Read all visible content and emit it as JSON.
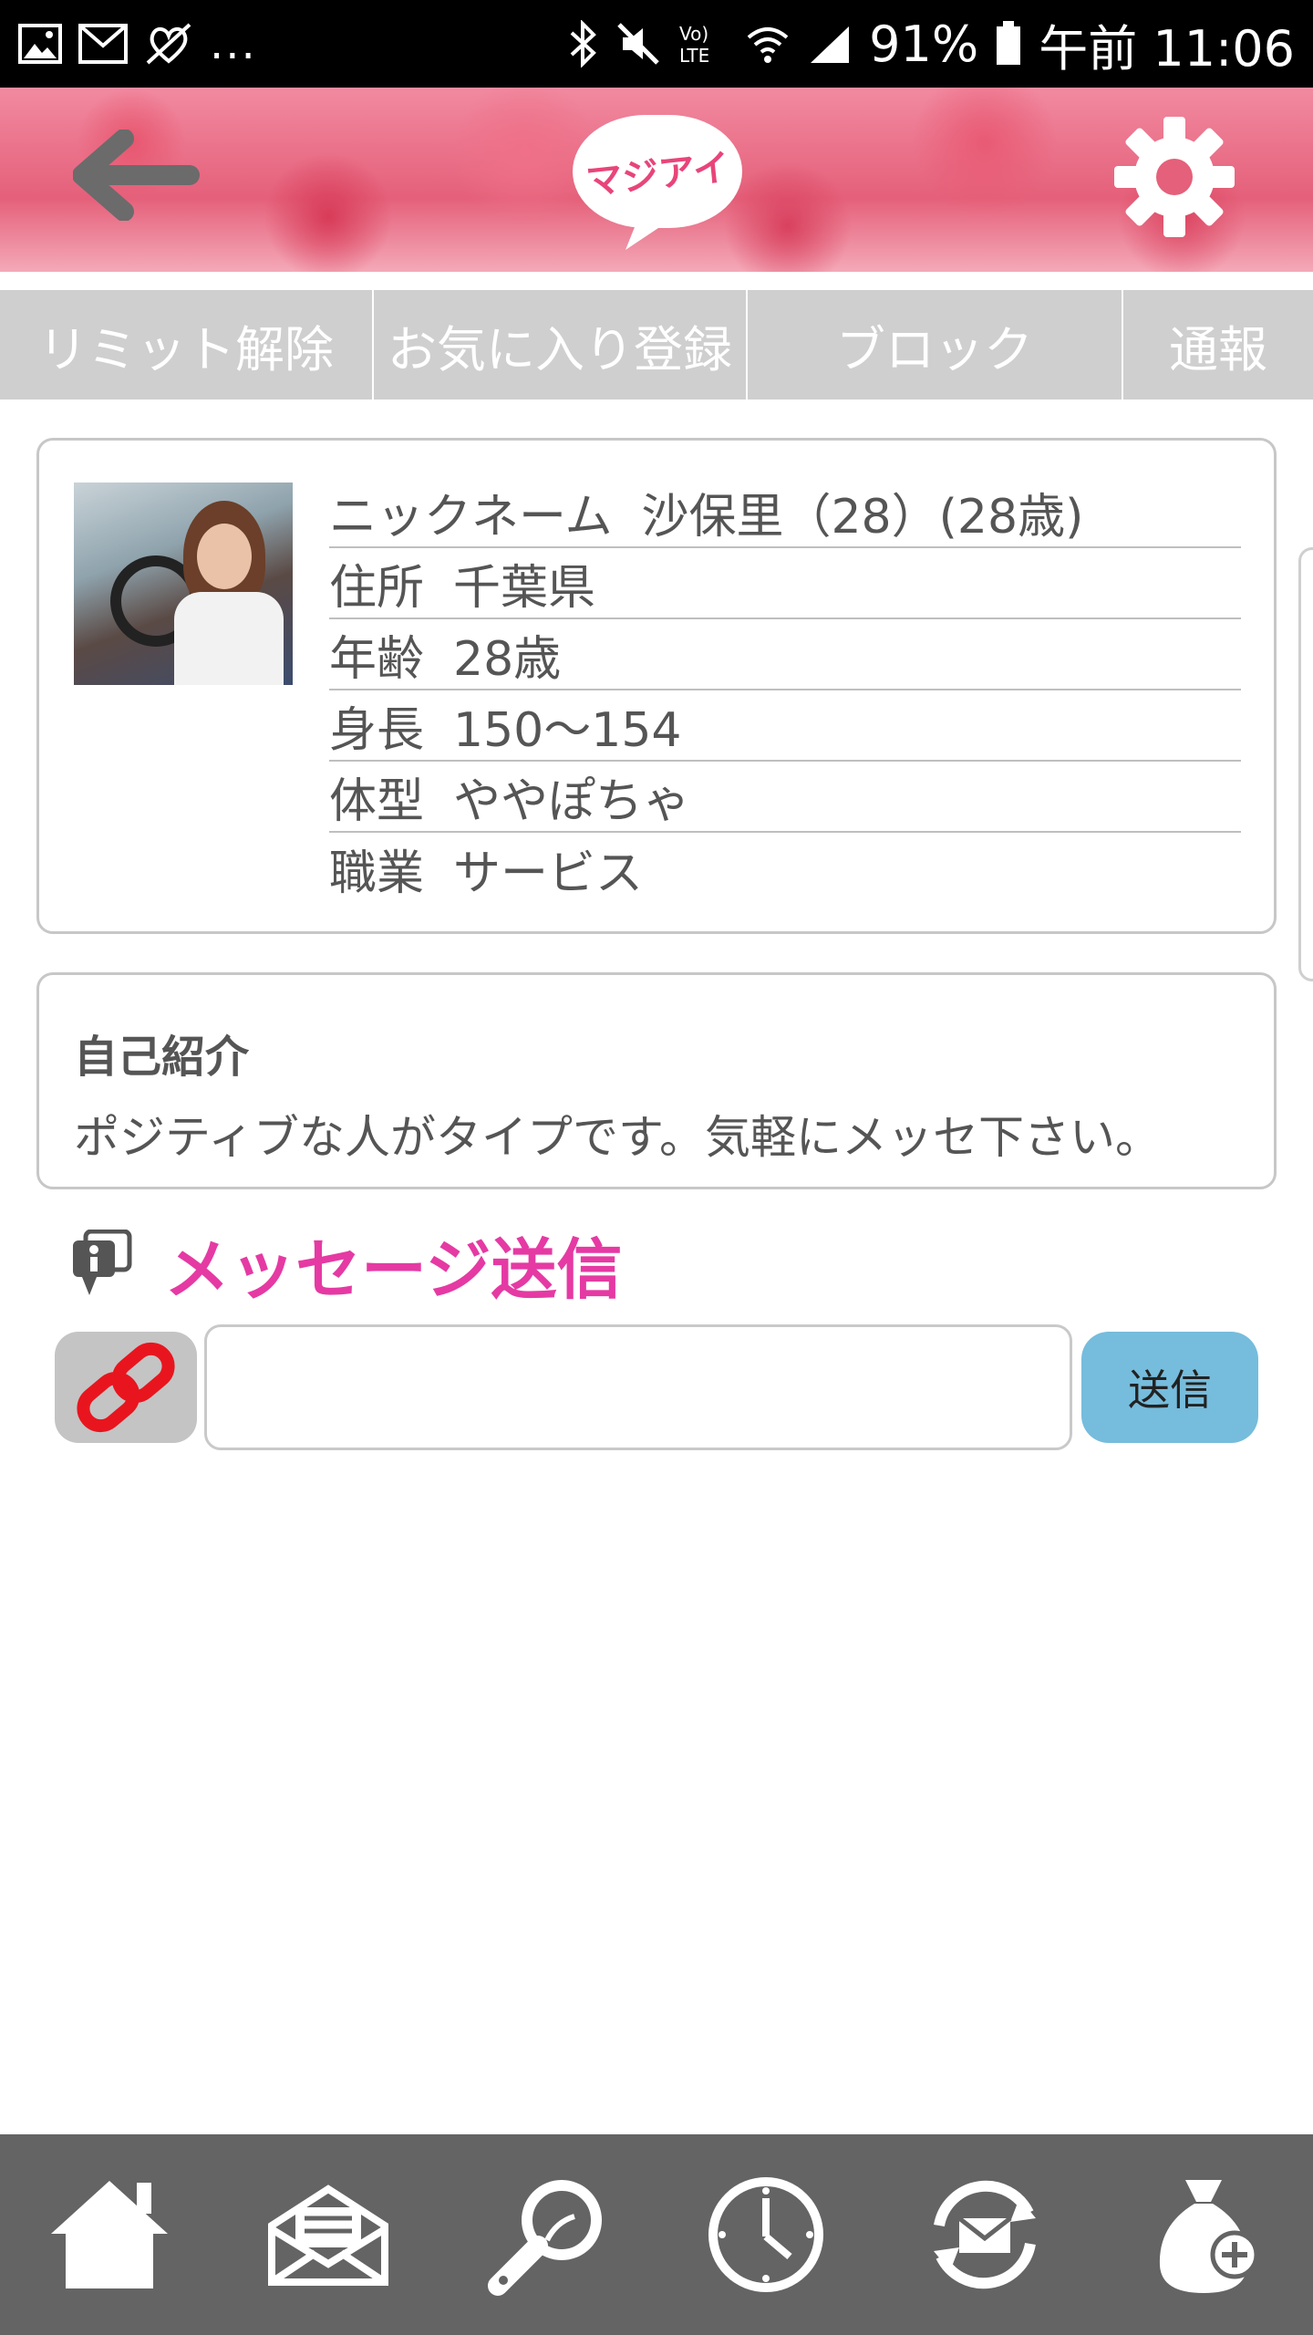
{
  "status_bar": {
    "battery": "91%",
    "time": "午前 11:06",
    "network": "LTE",
    "notifications_more": "..."
  },
  "header": {
    "logo_text": "マジアイ",
    "back_icon": "back-arrow-icon",
    "settings_icon": "gear-icon"
  },
  "tabs": [
    {
      "label": "リミット解除"
    },
    {
      "label": "お気に入り登録"
    },
    {
      "label": "ブロック"
    },
    {
      "label": "通報"
    }
  ],
  "profile": {
    "rows": [
      {
        "key": "ニックネーム",
        "value": "沙保里（28）(28歳)"
      },
      {
        "key": "住所",
        "value": "千葉県"
      },
      {
        "key": "年齢",
        "value": "28歳"
      },
      {
        "key": "身長",
        "value": "150～154"
      },
      {
        "key": "体型",
        "value": "ややぽちゃ"
      },
      {
        "key": "職業",
        "value": "サービス"
      }
    ]
  },
  "intro": {
    "title": "自己紹介",
    "text": "ポジティブな人がタイプです。気軽にメッセ下さい。"
  },
  "message": {
    "title": "メッセージ送信",
    "input_value": "",
    "send_label": "送信"
  },
  "colors": {
    "accent_pink": "#e53aa3",
    "send_button": "#76bcdc",
    "tab_bar": "#cfcfcf",
    "bottom_nav": "#646464"
  },
  "bottom_nav": [
    {
      "icon": "home-icon"
    },
    {
      "icon": "mail-icon"
    },
    {
      "icon": "search-icon"
    },
    {
      "icon": "clock-icon"
    },
    {
      "icon": "mail-sync-icon"
    },
    {
      "icon": "points-bag-icon"
    }
  ]
}
